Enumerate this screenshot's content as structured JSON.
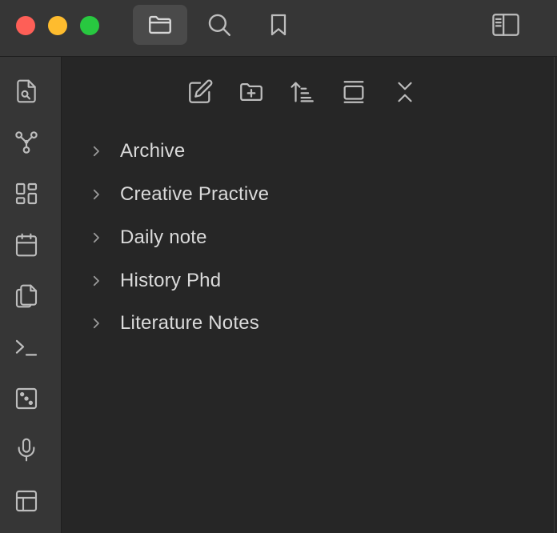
{
  "titlebar": {
    "tabs": [
      {
        "icon": "folder-icon",
        "active": true
      },
      {
        "icon": "search-icon",
        "active": false
      },
      {
        "icon": "bookmark-icon",
        "active": false
      }
    ],
    "right_icon": "sidebar-toggle-icon"
  },
  "ribbon": {
    "items": [
      {
        "icon": "file-search-icon"
      },
      {
        "icon": "graph-icon"
      },
      {
        "icon": "blocks-icon"
      },
      {
        "icon": "calendar-icon"
      },
      {
        "icon": "copy-icon"
      },
      {
        "icon": "terminal-icon"
      },
      {
        "icon": "dice-icon"
      },
      {
        "icon": "microphone-icon"
      },
      {
        "icon": "layout-icon"
      }
    ]
  },
  "explorer": {
    "toolbar": [
      {
        "icon": "new-note-icon"
      },
      {
        "icon": "new-folder-icon"
      },
      {
        "icon": "sort-icon"
      },
      {
        "icon": "auto-reveal-icon"
      },
      {
        "icon": "collapse-all-icon"
      }
    ],
    "folders": [
      {
        "label": "Archive"
      },
      {
        "label": "Creative Practive"
      },
      {
        "label": "Daily note"
      },
      {
        "label": "History Phd"
      },
      {
        "label": "Literature Notes"
      }
    ]
  },
  "colors": {
    "titlebar_bg": "#363636",
    "pane_bg": "#262626",
    "icon": "#bdbdbd",
    "text": "#dadada",
    "close": "#fe5f57",
    "minimize": "#febc2e",
    "maximize": "#28c840"
  }
}
